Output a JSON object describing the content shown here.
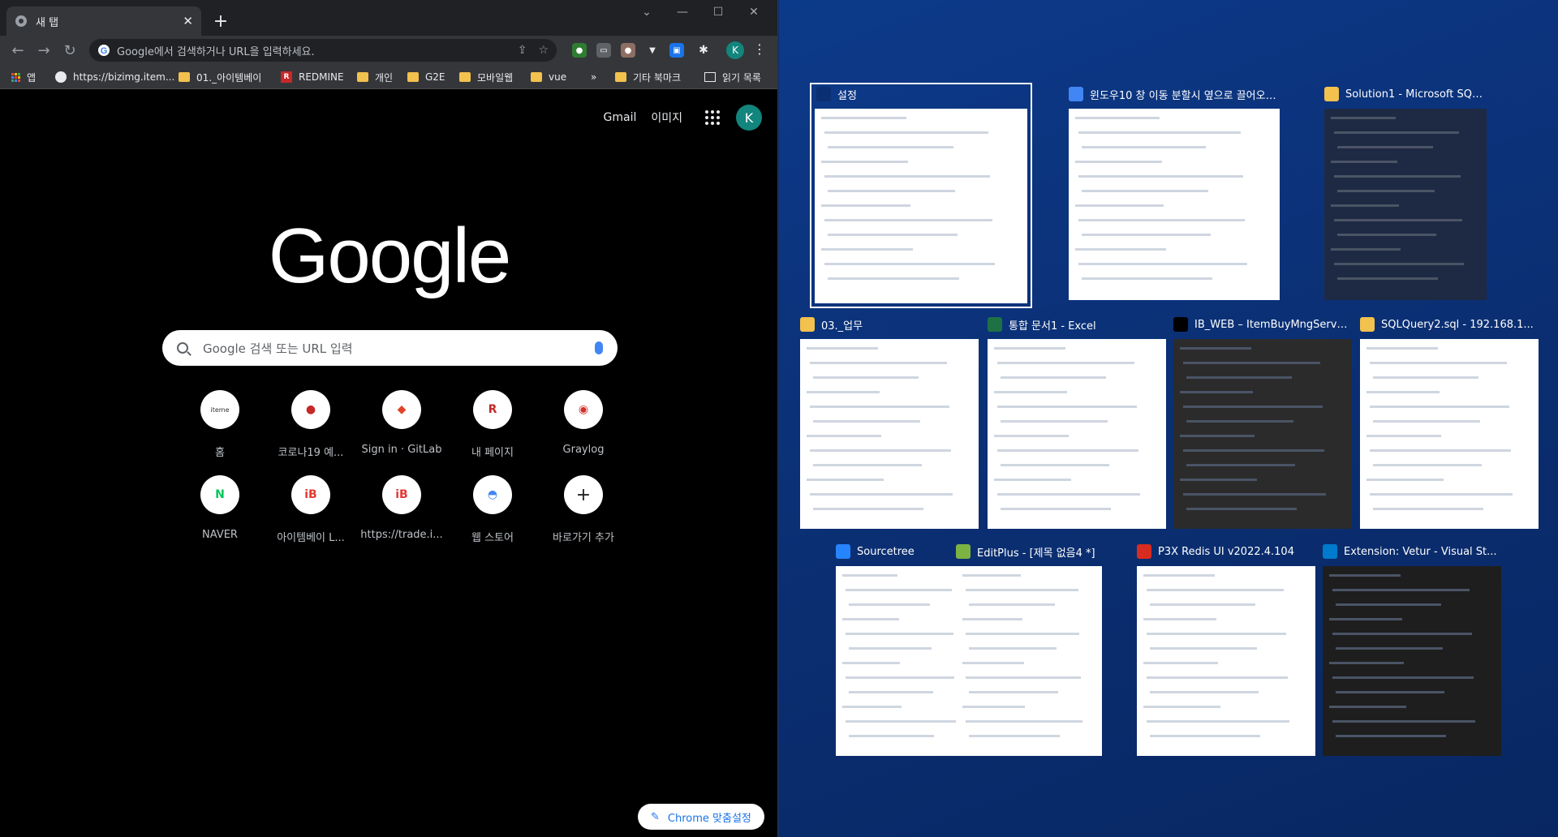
{
  "chrome": {
    "tab_title": "새 탭",
    "new_tab_symbol": "+",
    "omnibox_placeholder": "Google에서 검색하거나 URL을 입력하세요.",
    "profile_initial": "K",
    "bookmarks": [
      {
        "label": "앱",
        "icon": "apps-grid-icon"
      },
      {
        "label": "https://bizimg.item...",
        "icon": "globe-icon"
      },
      {
        "label": "01._아이템베이",
        "icon": "folder-icon"
      },
      {
        "label": "REDMINE",
        "icon": "redmine-icon"
      },
      {
        "label": "개인",
        "icon": "folder-icon"
      },
      {
        "label": "G2E",
        "icon": "folder-icon"
      },
      {
        "label": "모바일웹",
        "icon": "folder-icon"
      },
      {
        "label": "vue",
        "icon": "folder-icon"
      }
    ],
    "bookmarks_overflow": "»",
    "other_bookmarks": "기타 북마크",
    "reading_list": "읽기 목록"
  },
  "ntp": {
    "gmail": "Gmail",
    "images": "이미지",
    "profile_initial": "K",
    "logo": "Google",
    "search_placeholder": "Google 검색 또는 URL 입력",
    "shortcuts": [
      {
        "label": "홈",
        "glyph": "iteme",
        "color": "#333333"
      },
      {
        "label": "코로나19 예...",
        "glyph": "●",
        "color": "#c62828"
      },
      {
        "label": "Sign in · GitLab",
        "glyph": "◆",
        "color": "#e24329"
      },
      {
        "label": "내 페이지",
        "glyph": "R",
        "color": "#c62828"
      },
      {
        "label": "Graylog",
        "glyph": "◉",
        "color": "#d32f2f"
      },
      {
        "label": "NAVER",
        "glyph": "N",
        "color": "#03c75a"
      },
      {
        "label": "아이템베이 L...",
        "glyph": "iB",
        "color": "#e53935"
      },
      {
        "label": "https://trade.i...",
        "glyph": "iB",
        "color": "#e53935"
      },
      {
        "label": "웹 스토어",
        "glyph": "◓",
        "color": "#4285f4"
      },
      {
        "label": "바로가기 추가",
        "glyph": "+",
        "color": "#202124"
      }
    ],
    "customize_label": "Chrome 맞춤설정"
  },
  "snap": {
    "windows": [
      {
        "title": "설정",
        "icon": "gear-icon",
        "icon_color": "#0b2f73",
        "selected": true
      },
      {
        "title": "윈도우10 창 이동 분할시 옆으로 끌어오는...",
        "icon": "chrome-icon",
        "icon_color": "#4285f4"
      },
      {
        "title": "Solution1 - Microsoft SQL Serve...",
        "icon": "sql-server-icon",
        "icon_color": "#f2c14e"
      },
      {
        "title": "03._업무",
        "icon": "folder-icon",
        "icon_color": "#f2c14e"
      },
      {
        "title": "통합 문서1 - Excel",
        "icon": "excel-icon",
        "icon_color": "#1e7145"
      },
      {
        "title": "IB_WEB – ItemBuyMngServi...",
        "icon": "intellij-icon",
        "icon_color": "#000000"
      },
      {
        "title": "SQLQuery2.sql - 192.168.1...",
        "icon": "sql-server-icon",
        "icon_color": "#f2c14e"
      },
      {
        "title": "Sourcetree",
        "icon": "sourcetree-icon",
        "icon_color": "#2684ff"
      },
      {
        "title": "EditPlus - [제목 없음4 *]",
        "icon": "editplus-icon",
        "icon_color": "#7cb342"
      },
      {
        "title": "P3X Redis UI v2022.4.104",
        "icon": "redis-icon",
        "icon_color": "#d82c20"
      },
      {
        "title": "Extension: Vetur - Visual St...",
        "icon": "vscode-icon",
        "icon_color": "#007acc"
      }
    ]
  }
}
